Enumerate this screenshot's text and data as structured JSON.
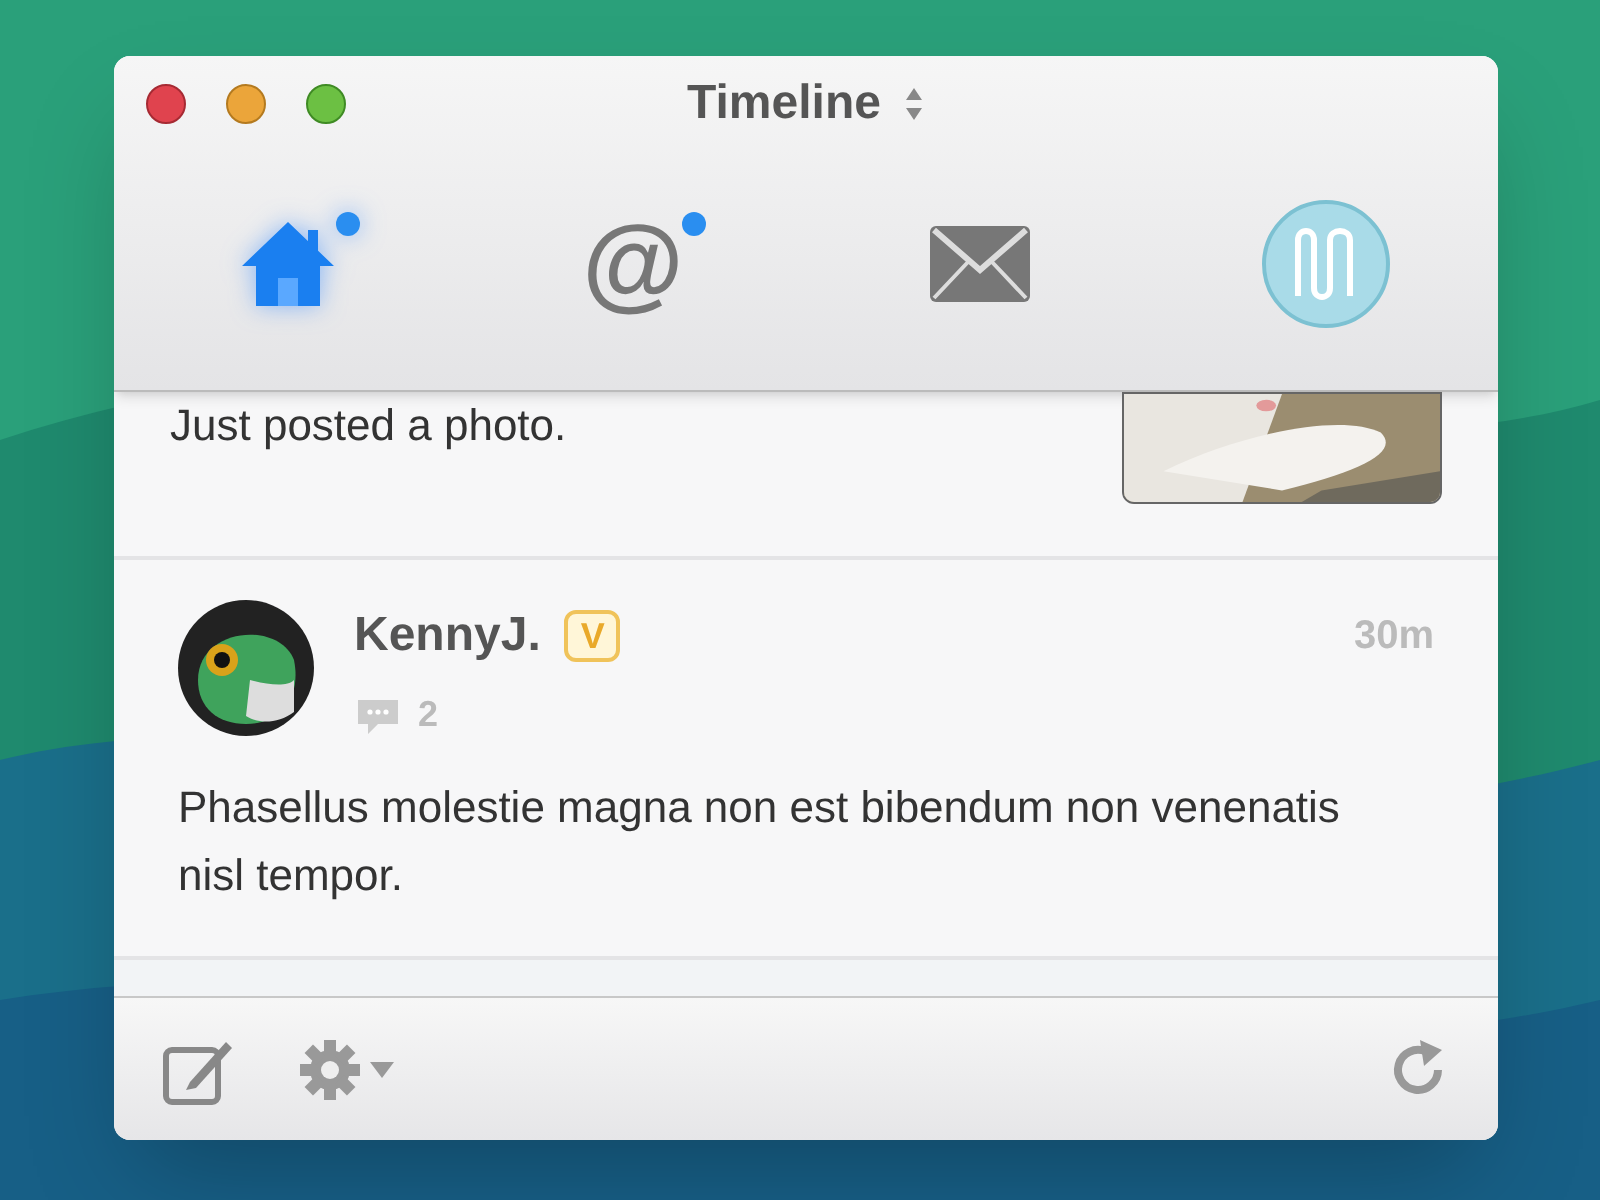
{
  "window": {
    "title": "Timeline"
  },
  "tabs": [
    {
      "kind": "home",
      "selected": true,
      "unread": true
    },
    {
      "kind": "mentions",
      "selected": false,
      "unread": true,
      "glyph": "@"
    },
    {
      "kind": "messages",
      "selected": false,
      "unread": false
    },
    {
      "kind": "profile",
      "selected": false,
      "unread": false
    }
  ],
  "posts": [
    {
      "text": "Just posted a photo."
    },
    {
      "author": "KennyJ.",
      "badge": "V",
      "time": "30m",
      "comments": "2",
      "text": "Phasellus molestie magna non est bibendum non venenatis nisl tempor."
    }
  ]
}
